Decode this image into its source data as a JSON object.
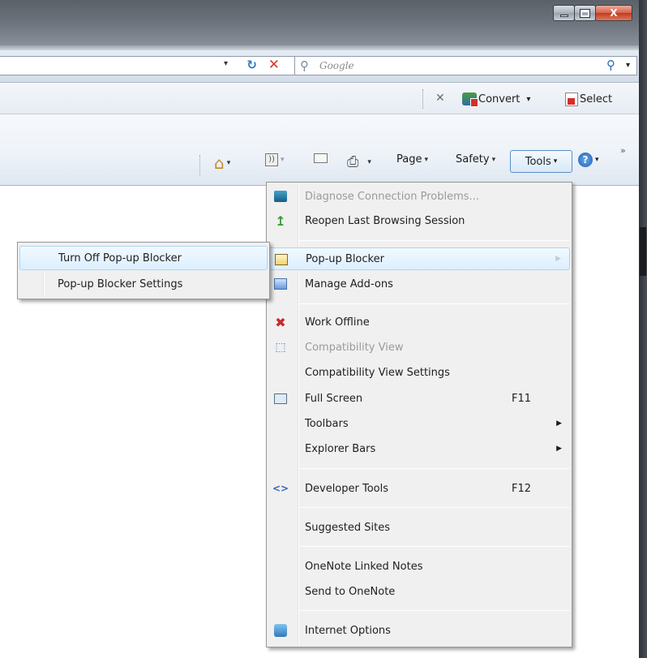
{
  "window": {
    "controls": {
      "minimize_icon": "minimize-icon",
      "maximize_icon": "maximize-icon",
      "close_label": "X"
    }
  },
  "address_bar": {
    "dropdown_glyph": "▾",
    "refresh_glyph": "↻",
    "stop_glyph": "✕"
  },
  "search": {
    "placeholder": "Google",
    "search_glyph": "⚲",
    "dropdown_glyph": "▾"
  },
  "links_bar": {
    "close_glyph": "✕",
    "convert_label": "Convert",
    "select_label": "Select",
    "dropdown_glyph": "▾"
  },
  "command_bar": {
    "page_label": "Page",
    "safety_label": "Safety",
    "tools_label": "Tools",
    "help_glyph": "?",
    "arrow_glyph": "▾",
    "overflow_glyph": "»"
  },
  "tools_menu": {
    "items": [
      {
        "label": "Diagnose Connection Problems...",
        "disabled": true,
        "icon": "globe-icon"
      },
      {
        "label": "Reopen Last Browsing Session",
        "icon": "reopen-icon"
      },
      {
        "label": "Pop-up Blocker",
        "icon": "popup-blocker-icon",
        "submenu": true,
        "highlighted": true
      },
      {
        "label": "Manage Add-ons",
        "icon": "addons-icon"
      },
      {
        "label": "Work Offline",
        "icon": "work-offline-icon"
      },
      {
        "label": "Compatibility View",
        "disabled": true,
        "icon": "compatibility-icon"
      },
      {
        "label": "Compatibility View Settings"
      },
      {
        "label": "Full Screen",
        "shortcut": "F11",
        "icon": "full-screen-icon"
      },
      {
        "label": "Toolbars",
        "submenu": true
      },
      {
        "label": "Explorer Bars",
        "submenu": true
      },
      {
        "label": "Developer Tools",
        "shortcut": "F12",
        "icon": "developer-tools-icon"
      },
      {
        "label": "Suggested Sites"
      },
      {
        "label": "OneNote Linked Notes"
      },
      {
        "label": "Send to OneNote"
      },
      {
        "label": "Internet Options",
        "icon": "internet-options-icon"
      }
    ],
    "submenu_glyph": "▶"
  },
  "popup_submenu": {
    "items": [
      {
        "label": "Turn Off Pop-up Blocker",
        "highlighted": true
      },
      {
        "label": "Pop-up Blocker Settings"
      }
    ]
  }
}
